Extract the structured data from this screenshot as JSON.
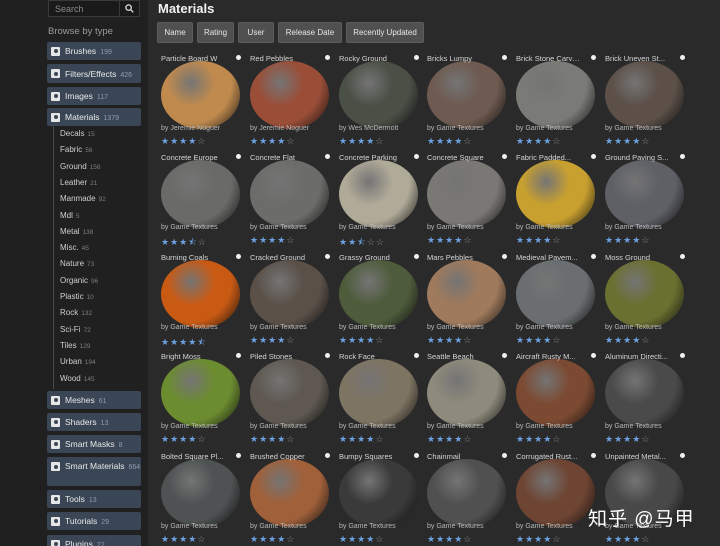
{
  "sidebar": {
    "search": {
      "placeholder": "Search"
    },
    "browse_label": "Browse by type",
    "categories": [
      {
        "label": "Brushes",
        "count": "199"
      },
      {
        "label": "Filters/Effects",
        "count": "426"
      },
      {
        "label": "Images",
        "count": "117"
      },
      {
        "label": "Materials",
        "count": "1379"
      },
      {
        "label": "Meshes",
        "count": "61"
      },
      {
        "label": "Shaders",
        "count": "13"
      },
      {
        "label": "Smart Masks",
        "count": "8"
      },
      {
        "label": "Smart Materials",
        "count": "664"
      },
      {
        "label": "Tools",
        "count": "13"
      },
      {
        "label": "Tutorials",
        "count": "29"
      },
      {
        "label": "Plugins",
        "count": "22"
      }
    ],
    "subcategories": [
      {
        "label": "Decals",
        "count": "15"
      },
      {
        "label": "Fabric",
        "count": "56"
      },
      {
        "label": "Ground",
        "count": "156"
      },
      {
        "label": "Leather",
        "count": "21"
      },
      {
        "label": "Manmade",
        "count": "92"
      },
      {
        "label": "Mdl",
        "count": "5"
      },
      {
        "label": "Metal",
        "count": "138"
      },
      {
        "label": "Misc.",
        "count": "45"
      },
      {
        "label": "Nature",
        "count": "73"
      },
      {
        "label": "Organic",
        "count": "96"
      },
      {
        "label": "Plastic",
        "count": "10"
      },
      {
        "label": "Rock",
        "count": "132"
      },
      {
        "label": "Sci-Fi",
        "count": "72"
      },
      {
        "label": "Tiles",
        "count": "129"
      },
      {
        "label": "Urban",
        "count": "194"
      },
      {
        "label": "Wood",
        "count": "145"
      }
    ]
  },
  "main": {
    "title": "Materials",
    "sort_buttons": [
      "Name",
      "Rating",
      "User",
      "Release Date",
      "Recently Updated"
    ],
    "materials": [
      {
        "name": "Particle Board W",
        "author": "by Jeremie Noguer",
        "rating": 4,
        "color": "#c08a4e"
      },
      {
        "name": "Red Pebbles",
        "author": "by Jeremie Noguer",
        "rating": 4,
        "color": "#9a4e38"
      },
      {
        "name": "Rocky Ground",
        "author": "by Wes McDermott",
        "rating": 4,
        "color": "#4a5046"
      },
      {
        "name": "Bricks Lumpy",
        "author": "by Game Textures",
        "rating": 4,
        "color": "#6e5a50"
      },
      {
        "name": "Brick Stone Carved",
        "author": "by Game Textures",
        "rating": 4,
        "color": "#7a7a76"
      },
      {
        "name": "Brick Uneven St...",
        "author": "by Game Textures",
        "rating": 4,
        "color": "#5c5048"
      },
      {
        "name": "Concrete Europe",
        "author": "by Game Textures",
        "rating": 3.5,
        "color": "#6a6a68"
      },
      {
        "name": "Concrete Flat",
        "author": "by Game Textures",
        "rating": 4,
        "color": "#6c6c6a"
      },
      {
        "name": "Concrete Parking",
        "author": "by Game Textures",
        "rating": 2.5,
        "color": "#b0aa98"
      },
      {
        "name": "Concrete Square",
        "author": "by Game Textures",
        "rating": 4,
        "color": "#7a7874"
      },
      {
        "name": "Fabric Padded...",
        "author": "by Game Textures",
        "rating": 4,
        "color": "#c8a030"
      },
      {
        "name": "Ground Paving S...",
        "author": "by Game Textures",
        "rating": 4,
        "color": "#5e6066"
      },
      {
        "name": "Burning Coals",
        "author": "by Game Textures",
        "rating": 4.5,
        "color": "#c85a14"
      },
      {
        "name": "Cracked Ground",
        "author": "by Game Textures",
        "rating": 4,
        "color": "#5a5048"
      },
      {
        "name": "Grassy Ground",
        "author": "by Game Textures",
        "rating": 4,
        "color": "#4e5c3c"
      },
      {
        "name": "Mars Pebbles",
        "author": "by Game Textures",
        "rating": 4,
        "color": "#a07a5c"
      },
      {
        "name": "Medieval Pavem...",
        "author": "by Game Textures",
        "rating": 4,
        "color": "#6a6e70"
      },
      {
        "name": "Moss Ground",
        "author": "by Game Textures",
        "rating": 4,
        "color": "#6a7030"
      },
      {
        "name": "Bright Moss",
        "author": "by Game Textures",
        "rating": 4,
        "color": "#6c8c30"
      },
      {
        "name": "Piled Stones",
        "author": "by Game Textures",
        "rating": 4,
        "color": "#5e5850"
      },
      {
        "name": "Rock Face",
        "author": "by Game Textures",
        "rating": 4,
        "color": "#7e7462"
      },
      {
        "name": "Seattle Beach",
        "author": "by Game Textures",
        "rating": 4,
        "color": "#8e8a7c"
      },
      {
        "name": "Aircraft Rusty M...",
        "author": "by Game Textures",
        "rating": 4,
        "color": "#7c4a32"
      },
      {
        "name": "Aluminum Directi...",
        "author": "by Game Textures",
        "rating": 4,
        "color": "#4a4a4a"
      },
      {
        "name": "Bolted Square Pl...",
        "author": "by Game Textures",
        "rating": 4,
        "color": "#4e5252"
      },
      {
        "name": "Brushed Copper",
        "author": "by Game Textures",
        "rating": 4,
        "color": "#a0603a"
      },
      {
        "name": "Bumpy Squares",
        "author": "by Game Textures",
        "rating": 4,
        "color": "#3a3a3a"
      },
      {
        "name": "Chainmail",
        "author": "by Game Textures",
        "rating": 4,
        "color": "#505050"
      },
      {
        "name": "Corrugated Rust...",
        "author": "by Game Textures",
        "rating": 4,
        "color": "#6e4432"
      },
      {
        "name": "Unpainted Metal...",
        "author": "by Game Textures",
        "rating": 4,
        "color": "#484848"
      }
    ]
  },
  "watermark": "知乎 @马甲"
}
